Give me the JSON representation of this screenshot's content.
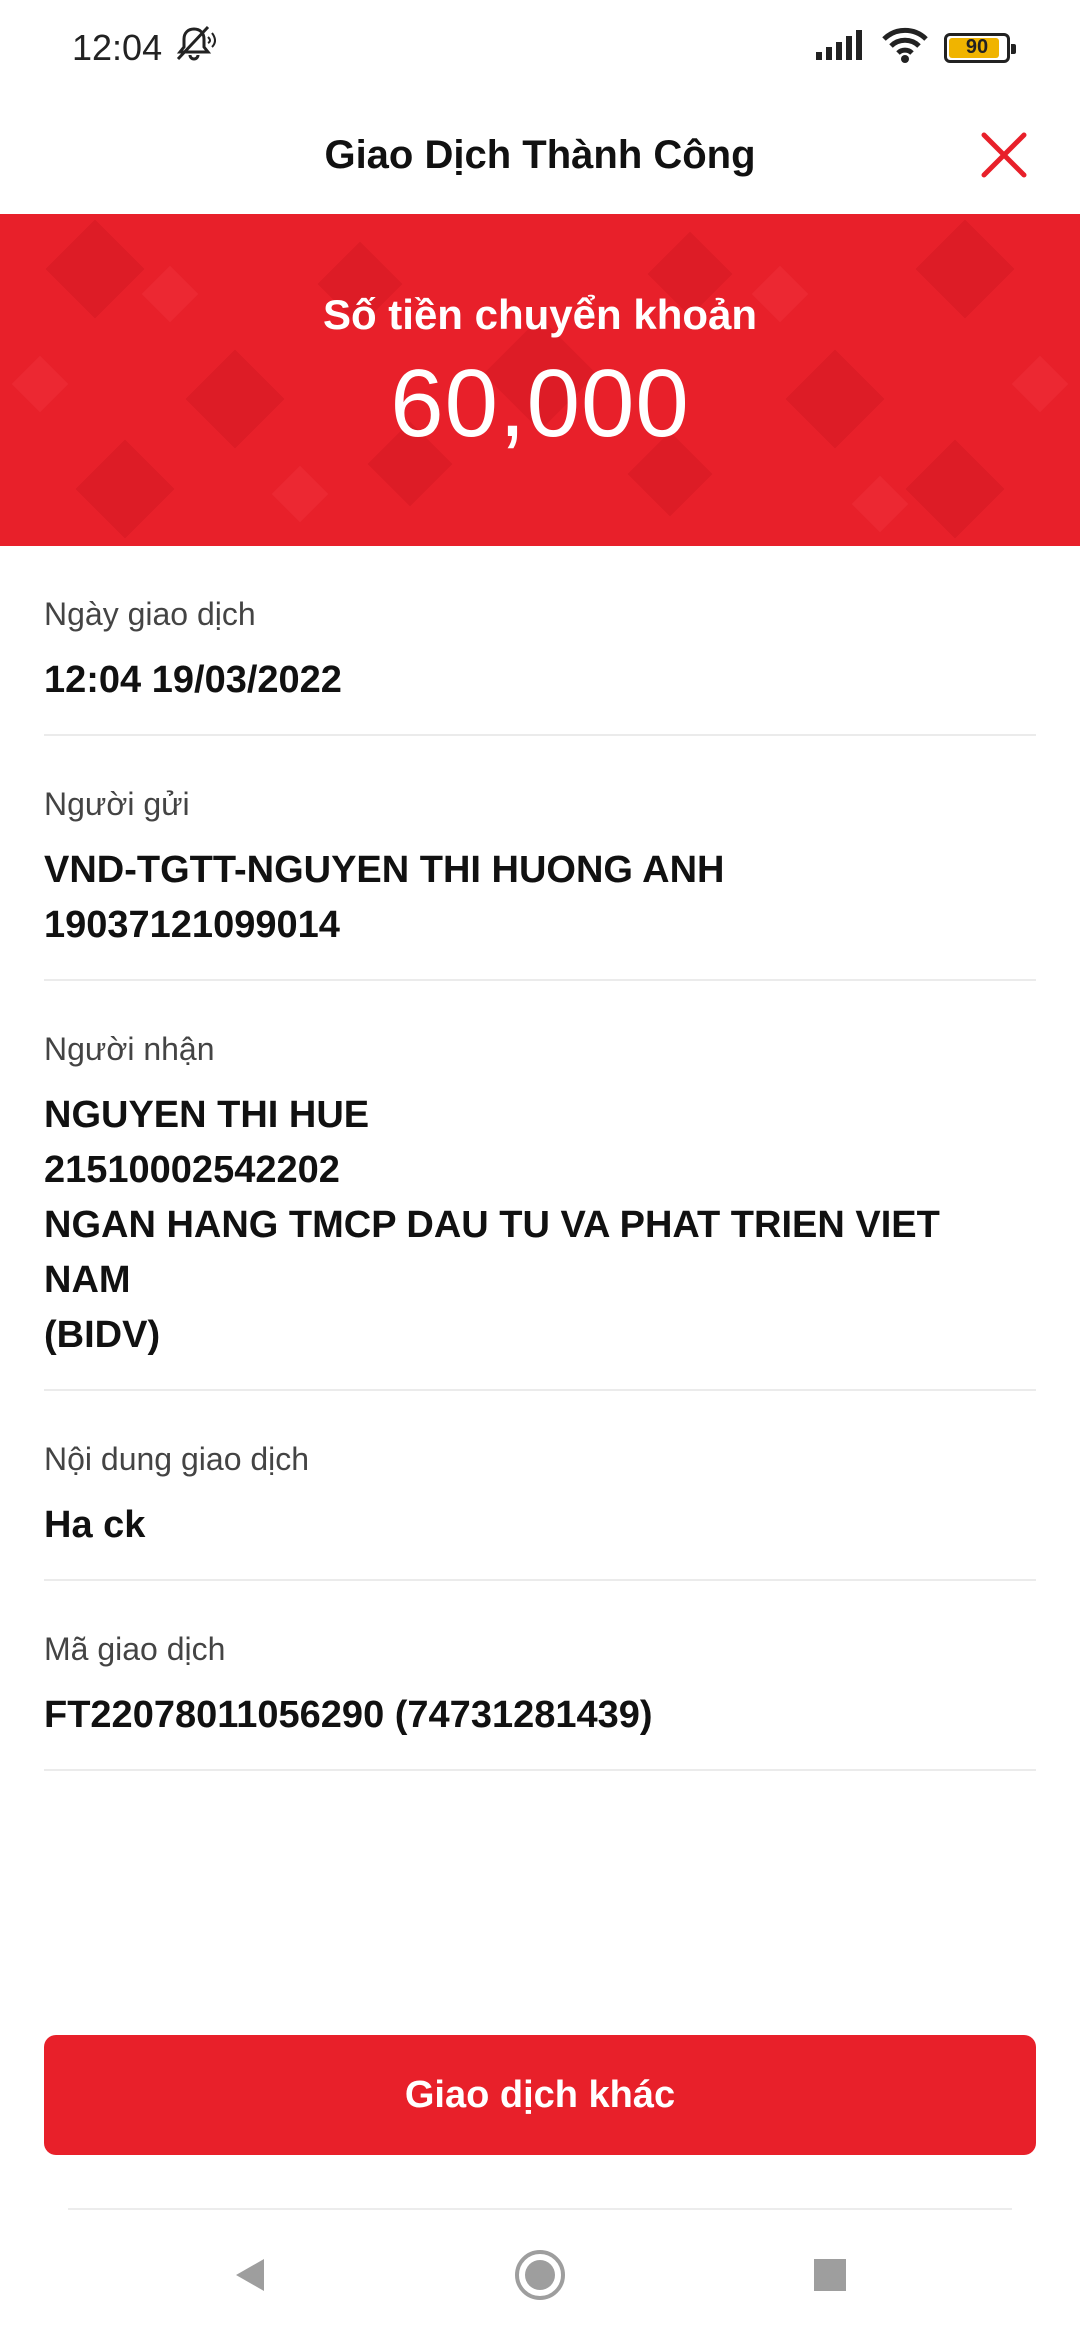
{
  "status_bar": {
    "time": "12:04",
    "battery_level": "90",
    "icons": [
      "mute-icon",
      "signal-icon",
      "wifi-icon",
      "battery-icon"
    ]
  },
  "header": {
    "title": "Giao Dịch Thành Công",
    "close_icon": "close-icon",
    "close_color": "#e8202a"
  },
  "hero": {
    "label": "Số tiền chuyển khoản",
    "amount": "60,000",
    "background_color": "#e8202a"
  },
  "details": {
    "date": {
      "label": "Ngày giao dịch",
      "value": "12:04 19/03/2022"
    },
    "sender": {
      "label": "Người gửi",
      "lines": [
        "VND-TGTT-NGUYEN THI HUONG ANH",
        "19037121099014"
      ]
    },
    "receiver": {
      "label": "Người nhận",
      "lines": [
        "NGUYEN THI HUE",
        "21510002542202",
        "NGAN HANG TMCP DAU TU VA PHAT TRIEN VIET NAM",
        "(BIDV)"
      ]
    },
    "content": {
      "label": "Nội dung giao dịch",
      "value": "Ha ck"
    },
    "transaction_id": {
      "label": "Mã giao dịch",
      "value": "FT22078011056290 (74731281439)"
    }
  },
  "actions": {
    "other_transaction": "Giao dịch khác"
  },
  "nav_bar": {
    "icons": [
      "back-icon",
      "home-icon",
      "recents-icon"
    ]
  }
}
